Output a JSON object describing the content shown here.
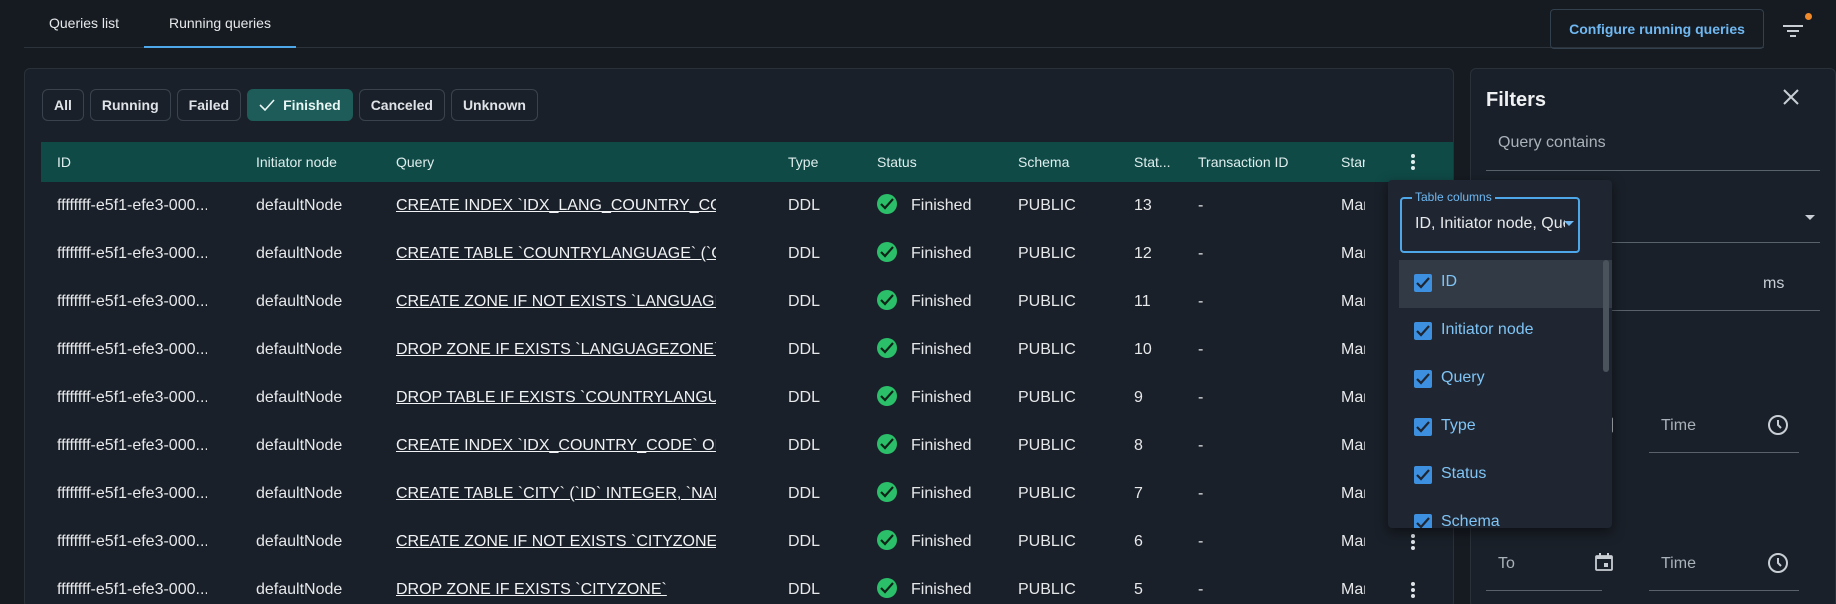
{
  "tabs": [
    {
      "label": "Queries list",
      "active": false
    },
    {
      "label": "Running queries",
      "active": true
    }
  ],
  "header": {
    "configure_label": "Configure running queries",
    "filter_icon": "filter-list-icon",
    "notification_color": "#f0892a"
  },
  "status_chips": [
    {
      "label": "All",
      "selected": false
    },
    {
      "label": "Running",
      "selected": false
    },
    {
      "label": "Failed",
      "selected": false
    },
    {
      "label": "Finished",
      "selected": true
    },
    {
      "label": "Canceled",
      "selected": false
    },
    {
      "label": "Unknown",
      "selected": false
    }
  ],
  "table": {
    "columns": [
      "ID",
      "Initiator node",
      "Query",
      "Type",
      "Status",
      "Schema",
      "Stat...",
      "Transaction ID",
      "Star"
    ],
    "rows": [
      {
        "id": "ffffffff-e5f1-efe3-000...",
        "node": "defaultNode",
        "query": "CREATE INDEX `IDX_LANG_COUNTRY_CODE` ON...",
        "type": "DDL",
        "status": "Finished",
        "schema": "PUBLIC",
        "stat": "13",
        "txn": "-",
        "start": "Mar"
      },
      {
        "id": "ffffffff-e5f1-efe3-000...",
        "node": "defaultNode",
        "query": "CREATE TABLE `COUNTRYLANGUAGE` (`COUNT...",
        "type": "DDL",
        "status": "Finished",
        "schema": "PUBLIC",
        "stat": "12",
        "txn": "-",
        "start": "Mar"
      },
      {
        "id": "ffffffff-e5f1-efe3-000...",
        "node": "defaultNode",
        "query": "CREATE ZONE IF NOT EXISTS `LANGUAGEZONE`...",
        "type": "DDL",
        "status": "Finished",
        "schema": "PUBLIC",
        "stat": "11",
        "txn": "-",
        "start": "Mar"
      },
      {
        "id": "ffffffff-e5f1-efe3-000...",
        "node": "defaultNode",
        "query": "DROP ZONE IF EXISTS `LANGUAGEZONE`",
        "type": "DDL",
        "status": "Finished",
        "schema": "PUBLIC",
        "stat": "10",
        "txn": "-",
        "start": "Mar"
      },
      {
        "id": "ffffffff-e5f1-efe3-000...",
        "node": "defaultNode",
        "query": "DROP TABLE IF EXISTS `COUNTRYLANGUAGE`",
        "type": "DDL",
        "status": "Finished",
        "schema": "PUBLIC",
        "stat": "9",
        "txn": "-",
        "start": "Mar"
      },
      {
        "id": "ffffffff-e5f1-efe3-000...",
        "node": "defaultNode",
        "query": "CREATE INDEX `IDX_COUNTRY_CODE` ON `CITY`...",
        "type": "DDL",
        "status": "Finished",
        "schema": "PUBLIC",
        "stat": "8",
        "txn": "-",
        "start": "Mar"
      },
      {
        "id": "ffffffff-e5f1-efe3-000...",
        "node": "defaultNode",
        "query": "CREATE TABLE `CITY` (`ID` INTEGER, `NAME` VA...",
        "type": "DDL",
        "status": "Finished",
        "schema": "PUBLIC",
        "stat": "7",
        "txn": "-",
        "start": "Mar"
      },
      {
        "id": "ffffffff-e5f1-efe3-000...",
        "node": "defaultNode",
        "query": "CREATE ZONE IF NOT EXISTS `CITYZONE` WITH ...",
        "type": "DDL",
        "status": "Finished",
        "schema": "PUBLIC",
        "stat": "6",
        "txn": "-",
        "start": "Mar"
      },
      {
        "id": "ffffffff-e5f1-efe3-000...",
        "node": "defaultNode",
        "query": "DROP ZONE IF EXISTS `CITYZONE`",
        "type": "DDL",
        "status": "Finished",
        "schema": "PUBLIC",
        "stat": "5",
        "txn": "-",
        "start": "Mar"
      }
    ]
  },
  "filters": {
    "title": "Filters",
    "query_contains_label": "Query contains",
    "duration_suffix": "ms",
    "time_label": "Time",
    "to_label": "To",
    "to_time_label": "Time"
  },
  "columns_select": {
    "legend": "Table columns",
    "value": "ID, Initiator node, Query, Type, Status, Schema, Stat...",
    "options": [
      {
        "label": "ID",
        "checked": true
      },
      {
        "label": "Initiator node",
        "checked": true
      },
      {
        "label": "Query",
        "checked": true
      },
      {
        "label": "Type",
        "checked": true
      },
      {
        "label": "Status",
        "checked": true
      },
      {
        "label": "Schema",
        "checked": true
      }
    ]
  },
  "colors": {
    "table_header": "#0f4a47",
    "selected_chip": "#1d5c59",
    "finished_status": "#2bbf6a",
    "accent": "#4ea7e8"
  }
}
